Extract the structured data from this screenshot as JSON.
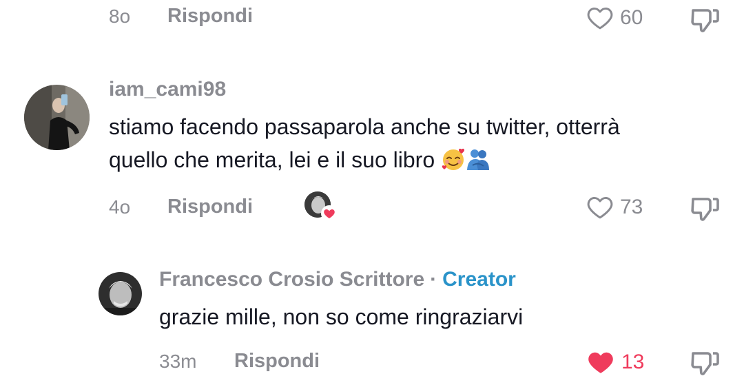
{
  "top_comment_footer": {
    "time": "8o",
    "reply_label": "Rispondi",
    "like_count": "60"
  },
  "comment_cami": {
    "username": "iam_cami98",
    "text_line1": "stiamo facendo passaparola anche su twitter, otterrà",
    "text_line2": "quello che merita, lei e il suo libro",
    "emojis": [
      "smiling-face-with-hearts",
      "people-hugging"
    ],
    "time": "4o",
    "reply_label": "Rispondi",
    "like_count": "73"
  },
  "reply_francesco": {
    "username": "Francesco Crosio Scrittore",
    "separator": "·",
    "creator_badge": "Creator",
    "text": "grazie mille, non so come ringraziarvi",
    "time": "33m",
    "reply_label": "Rispondi",
    "like_count": "13"
  },
  "colors": {
    "gray": "#8a8b91",
    "text": "#161823",
    "creator": "#2a93c9",
    "liked": "#ef3b5c"
  },
  "icons": [
    "heart-outline-icon",
    "dislike-icon",
    "heart-filled-icon",
    "creator-liked-avatar"
  ]
}
